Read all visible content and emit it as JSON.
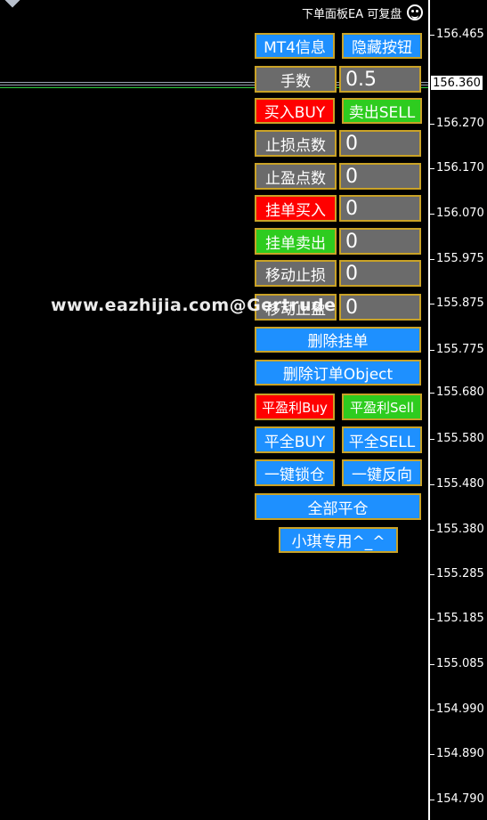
{
  "header": {
    "ea_title": "下单面板EA 可复盘",
    "smiley_icon": "smiley-face-icon"
  },
  "chart": {
    "current_price": "156.360",
    "price_ticks": [
      "156.465",
      "156.270",
      "156.170",
      "156.070",
      "155.975",
      "155.875",
      "155.775",
      "155.680",
      "155.580",
      "155.480",
      "155.380",
      "155.285",
      "155.185",
      "155.085",
      "154.990",
      "154.890",
      "154.790"
    ]
  },
  "panel": {
    "mt4_info": "MT4信息",
    "hide_buttons": "隐藏按钮",
    "lots_label": "手数",
    "lots_value": "0.5",
    "buy": "买入BUY",
    "sell": "卖出SELL",
    "stop_loss_label": "止损点数",
    "stop_loss_value": "0",
    "take_profit_label": "止盈点数",
    "take_profit_value": "0",
    "pending_buy_label": "挂单买入",
    "pending_buy_value": "0",
    "pending_sell_label": "挂单卖出",
    "pending_sell_value": "0",
    "trailing_stop_label": "移动止损",
    "trailing_stop_value": "0",
    "trailing_profit_label": "移动止盈",
    "trailing_profit_value": "0",
    "delete_pending": "删除挂单",
    "delete_objects": "删除订单Object",
    "close_profit_buy": "平盈利Buy",
    "close_profit_sell": "平盈利Sell",
    "close_all_buy": "平全BUY",
    "close_all_sell": "平全SELL",
    "lock": "一键锁仓",
    "reverse": "一键反向",
    "close_all": "全部平仓",
    "special": "小琪专用^_^"
  },
  "colors": {
    "blue": "#1e90ff",
    "gray": "#6b6b6b",
    "red": "#ff0000",
    "green": "#2ecc1f",
    "border": "#c9a227",
    "ask_line": "#2ecc40"
  },
  "watermark": "www.eazhijia.com@Gertrude"
}
